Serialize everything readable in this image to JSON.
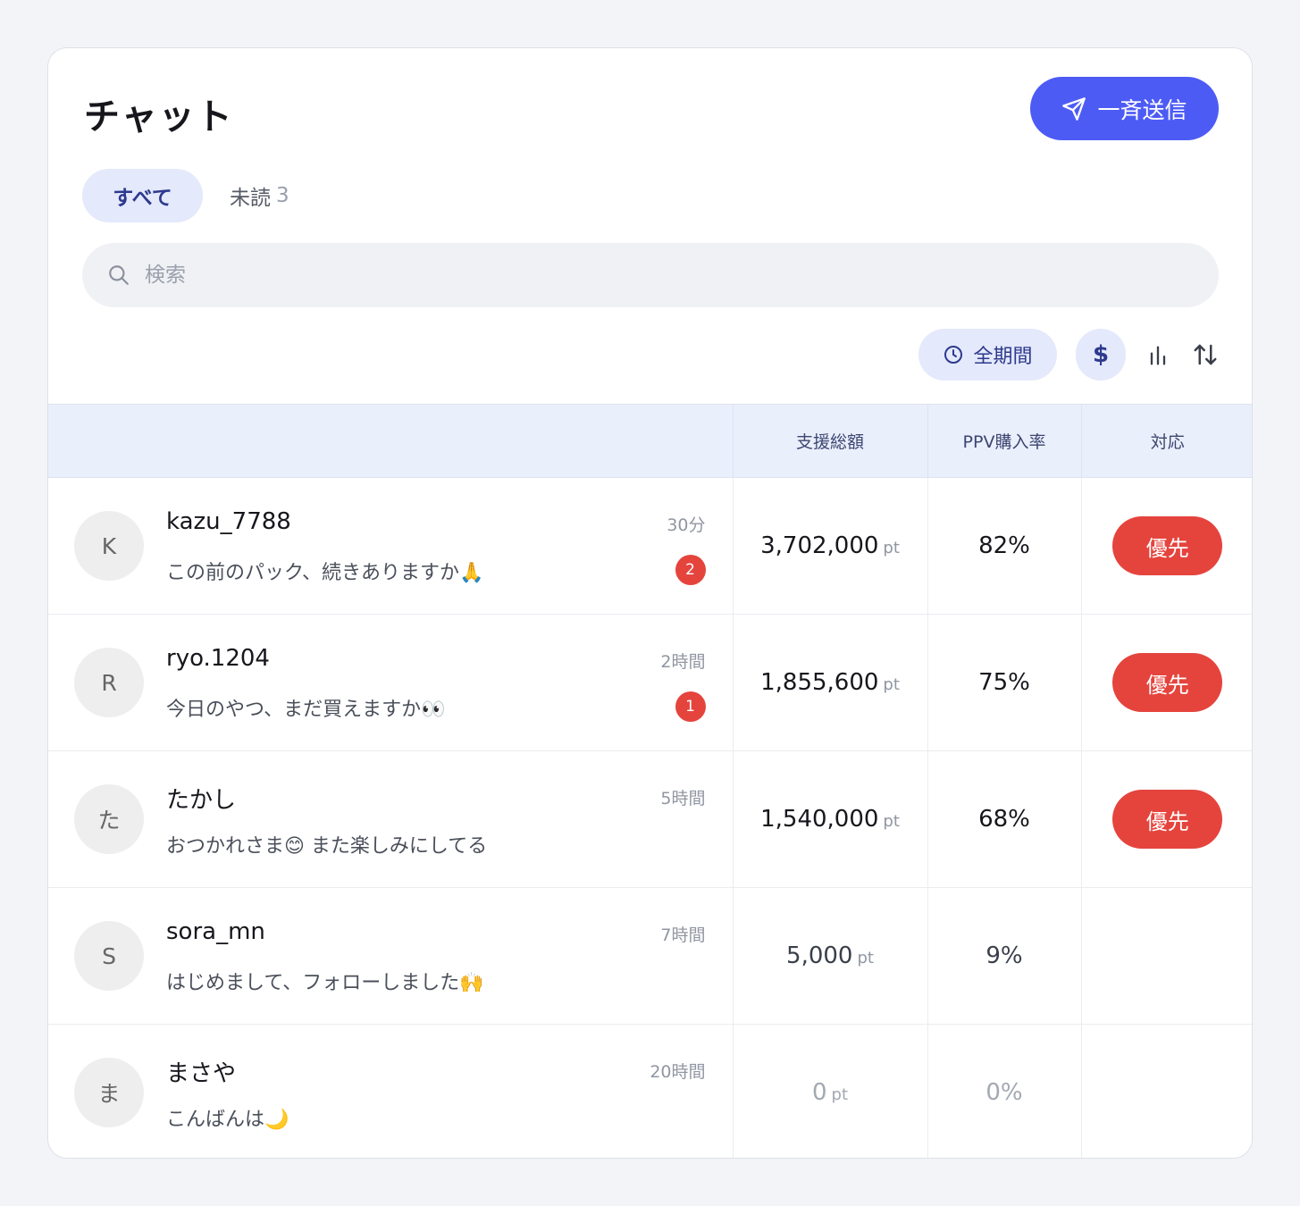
{
  "header": {
    "title": "チャット",
    "broadcast_label": "一斉送信"
  },
  "tabs": {
    "all_label": "すべて",
    "unread_label": "未読",
    "unread_count": "3"
  },
  "search": {
    "placeholder": "検索"
  },
  "filters": {
    "period_label": "全期間",
    "currency_symbol": "$"
  },
  "table": {
    "headers": {
      "chat": "",
      "total_support": "支援総額",
      "ppv_rate": "PPV購入率",
      "response": "対応"
    },
    "rows": [
      {
        "avatar": "K",
        "name": "kazu_7788",
        "time": "30分",
        "message": "この前のパック、続きありますか🙏",
        "unread": "2",
        "amount": "3,702,000",
        "unit": "pt",
        "rate": "82%",
        "action": "優先"
      },
      {
        "avatar": "R",
        "name": "ryo.1204",
        "time": "2時間",
        "message": "今日のやつ、まだ買えますか👀",
        "unread": "1",
        "amount": "1,855,600",
        "unit": "pt",
        "rate": "75%",
        "action": "優先"
      },
      {
        "avatar": "た",
        "name": "たかし",
        "time": "5時間",
        "message": "おつかれさま😊 また楽しみにしてる",
        "unread": null,
        "amount": "1,540,000",
        "unit": "pt",
        "rate": "68%",
        "action": "優先"
      },
      {
        "avatar": "S",
        "name": "sora_mn",
        "time": "7時間",
        "message": "はじめまして、フォローしました🙌",
        "unread": null,
        "amount": "5,000",
        "unit": "pt",
        "rate": "9%",
        "action": null
      },
      {
        "avatar": "ま",
        "name": "まさや",
        "time": "20時間",
        "message": "こんばんは🌙",
        "unread": null,
        "amount": "0",
        "unit": "pt",
        "rate": "0%",
        "action": null
      }
    ]
  },
  "colors": {
    "accent": "#4d5bf5",
    "priority": "#e5443d",
    "chip_bg": "#e4e9fb",
    "chip_text": "#2d3a8e"
  },
  "icons": {
    "broadcast": "send-icon",
    "search": "search-icon",
    "period": "clock-icon",
    "chart": "bar-chart-icon",
    "sort": "sort-icon"
  }
}
